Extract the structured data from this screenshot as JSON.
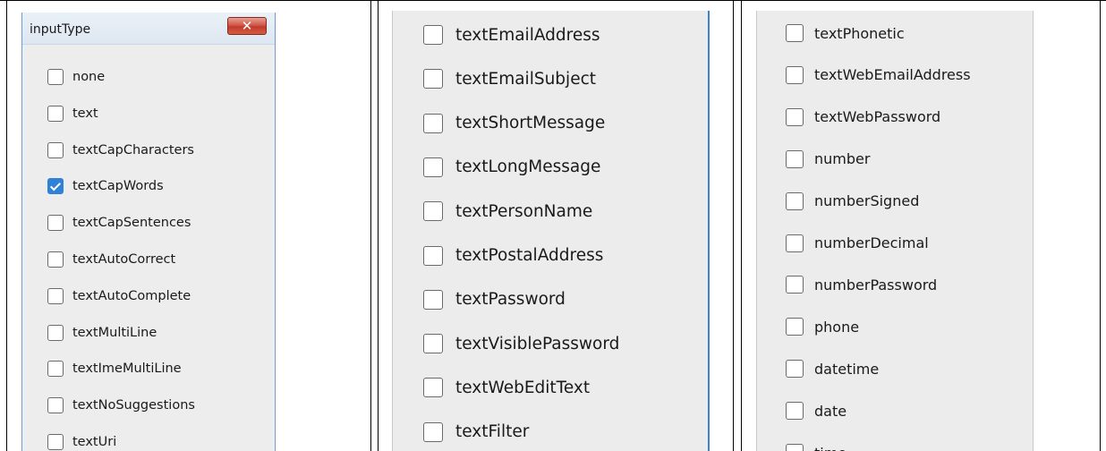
{
  "panel1": {
    "title": "inputType",
    "close_label": "✕",
    "items": [
      {
        "label": "none",
        "checked": false
      },
      {
        "label": "text",
        "checked": false
      },
      {
        "label": "textCapCharacters",
        "checked": false
      },
      {
        "label": "textCapWords",
        "checked": true
      },
      {
        "label": "textCapSentences",
        "checked": false
      },
      {
        "label": "textAutoCorrect",
        "checked": false
      },
      {
        "label": "textAutoComplete",
        "checked": false
      },
      {
        "label": "textMultiLine",
        "checked": false
      },
      {
        "label": "textImeMultiLine",
        "checked": false
      },
      {
        "label": "textNoSuggestions",
        "checked": false
      },
      {
        "label": "textUri",
        "checked": false
      }
    ]
  },
  "panel2": {
    "items": [
      {
        "label": "textEmailAddress",
        "checked": false
      },
      {
        "label": "textEmailSubject",
        "checked": false
      },
      {
        "label": "textShortMessage",
        "checked": false
      },
      {
        "label": "textLongMessage",
        "checked": false
      },
      {
        "label": "textPersonName",
        "checked": false
      },
      {
        "label": "textPostalAddress",
        "checked": false
      },
      {
        "label": "textPassword",
        "checked": false
      },
      {
        "label": "textVisiblePassword",
        "checked": false
      },
      {
        "label": "textWebEditText",
        "checked": false
      },
      {
        "label": "textFilter",
        "checked": false
      }
    ]
  },
  "panel3": {
    "items": [
      {
        "label": "textPhonetic",
        "checked": false
      },
      {
        "label": "textWebEmailAddress",
        "checked": false
      },
      {
        "label": "textWebPassword",
        "checked": false
      },
      {
        "label": "number",
        "checked": false
      },
      {
        "label": "numberSigned",
        "checked": false
      },
      {
        "label": "numberDecimal",
        "checked": false
      },
      {
        "label": "numberPassword",
        "checked": false
      },
      {
        "label": "phone",
        "checked": false
      },
      {
        "label": "datetime",
        "checked": false
      },
      {
        "label": "date",
        "checked": false
      },
      {
        "label": "time",
        "checked": false
      }
    ]
  },
  "colors": {
    "accent": "#2f82d8",
    "close_button": "#c23b2c"
  }
}
